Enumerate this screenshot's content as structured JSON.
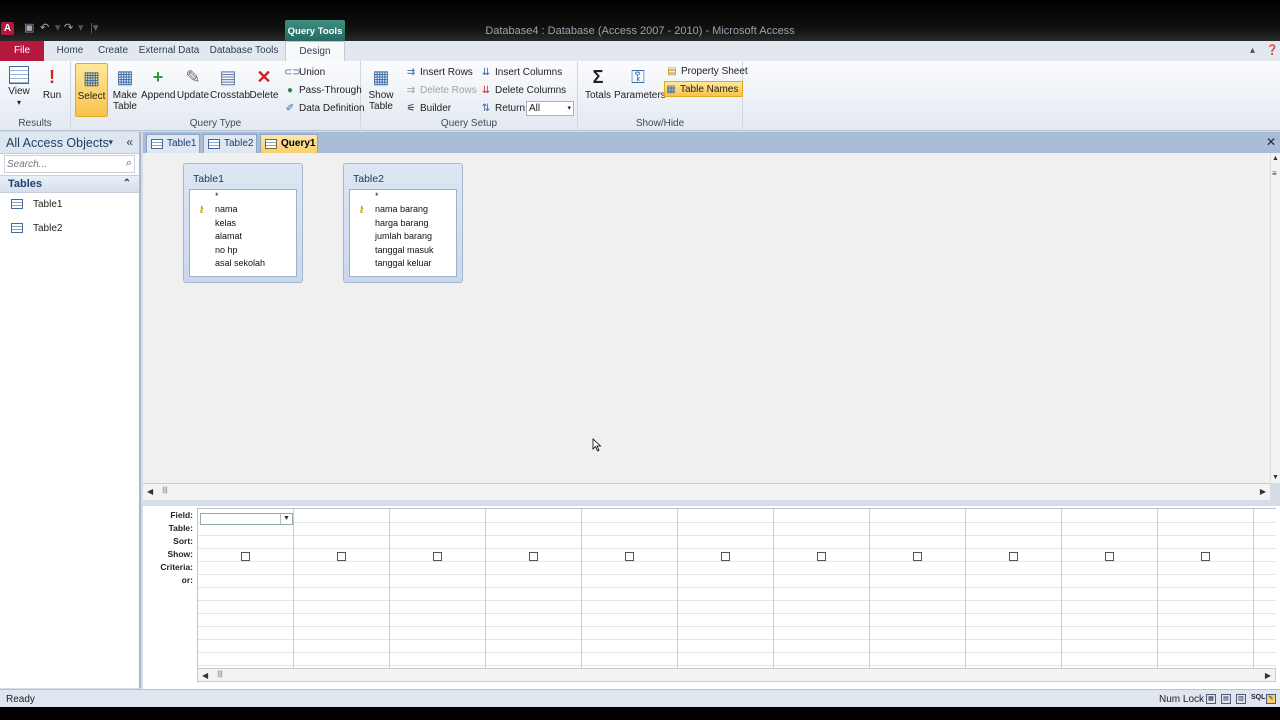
{
  "window": {
    "title": "Database4 : Database (Access 2007 - 2010)  -  Microsoft Access",
    "contextual_tab": "Query Tools",
    "app_letter": "A"
  },
  "ribbon_tabs": [
    "File",
    "Home",
    "Create",
    "External Data",
    "Database Tools",
    "Design"
  ],
  "ribbon": {
    "results": {
      "label": "Results",
      "view": "View",
      "run": "Run"
    },
    "query_type": {
      "label": "Query Type",
      "select": "Select",
      "make_table": "Make Table",
      "append": "Append",
      "update": "Update",
      "crosstab": "Crosstab",
      "delete": "Delete",
      "union": "Union",
      "pass_through": "Pass-Through",
      "data_definition": "Data Definition"
    },
    "query_setup": {
      "label": "Query Setup",
      "show_table": "Show Table",
      "insert_rows": "Insert Rows",
      "delete_rows": "Delete Rows",
      "builder": "Builder",
      "insert_columns": "Insert Columns",
      "delete_columns": "Delete Columns",
      "return_label": "Return:",
      "return_value": "All"
    },
    "show_hide": {
      "label": "Show/Hide",
      "totals": "Totals",
      "parameters": "Parameters",
      "property_sheet": "Property Sheet",
      "table_names": "Table Names"
    }
  },
  "nav": {
    "header": "All Access Objects",
    "search_placeholder": "Search...",
    "group": "Tables",
    "items": [
      "Table1",
      "Table2"
    ]
  },
  "doc_tabs": [
    "Table1",
    "Table2",
    "Query1"
  ],
  "field_lists": [
    {
      "title": "Table1",
      "fields": [
        "*",
        "nama",
        "kelas",
        "alamat",
        "no hp",
        "asal sekolah"
      ],
      "key_field": "nama"
    },
    {
      "title": "Table2",
      "fields": [
        "*",
        "nama barang",
        "harga barang",
        "jumlah barang",
        "tanggal masuk",
        "tanggal keluar"
      ],
      "key_field": "nama barang"
    }
  ],
  "qbe_rows": [
    "Field:",
    "Table:",
    "Sort:",
    "Show:",
    "Criteria:",
    "or:"
  ],
  "status": {
    "text": "Ready",
    "num_lock": "Num Lock",
    "sql_icon": "SQL"
  }
}
